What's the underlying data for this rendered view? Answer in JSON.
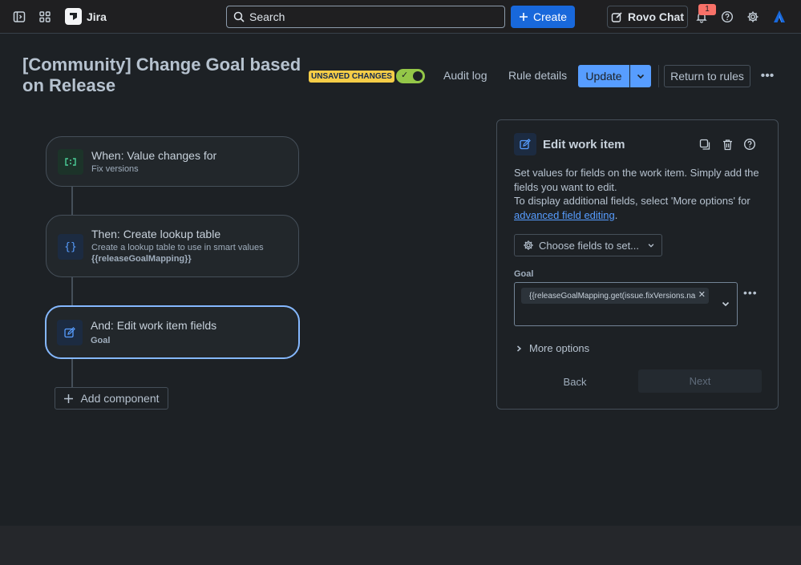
{
  "topnav": {
    "app_name": "Jira",
    "search_placeholder": "Search",
    "create_label": "Create",
    "rovo_label": "Rovo Chat",
    "notification_count": "1"
  },
  "header": {
    "title": "[Community] Change Goal based on Release",
    "unsaved_label": "UNSAVED CHANGES",
    "audit_log": "Audit log",
    "rule_details": "Rule details",
    "update_label": "Update",
    "return_label": "Return to rules",
    "rule_enabled": true
  },
  "flow": {
    "nodes": [
      {
        "title": "When: Value changes for",
        "subtitle": "Fix versions"
      },
      {
        "title": "Then: Create lookup table",
        "subtitle": "Create a lookup table to use in smart values",
        "detail": "{{releaseGoalMapping}}"
      },
      {
        "title": "And: Edit work item fields",
        "detail": "Goal"
      }
    ],
    "add_component": "Add component"
  },
  "panel": {
    "title": "Edit work item",
    "desc_line1": "Set values for fields on the work item. Simply add the fields you want to edit.",
    "desc_line2_prefix": "To display additional fields, select 'More options' for ",
    "desc_link": "advanced field editing",
    "desc_line2_suffix": ".",
    "choose_fields": "Choose fields to set...",
    "goal_label": "Goal",
    "goal_value": "{{releaseGoalMapping.get(issue.fixVersions.na",
    "more_options": "More options",
    "back_label": "Back",
    "next_label": "Next"
  },
  "colors": {
    "accent": "#579dff",
    "create": "#1868db",
    "unsaved": "#f5cd47",
    "toggle_on": "#94c748"
  }
}
